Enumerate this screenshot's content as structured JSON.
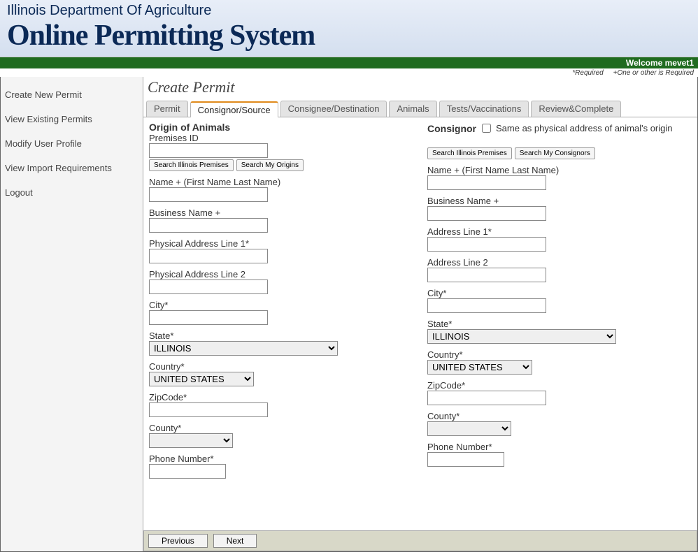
{
  "header": {
    "department": "Illinois Department Of Agriculture",
    "system": "Online Permitting System"
  },
  "welcome": "Welcome mevet1",
  "hints": {
    "required": "*Required",
    "oneOrOther": "+One or other is Required"
  },
  "sidebar": {
    "items": [
      "Create New Permit",
      "View Existing Permits",
      "Modify User Profile",
      "View Import Requirements",
      "Logout"
    ]
  },
  "page": {
    "title": "Create Permit"
  },
  "tabs": [
    "Permit",
    "Consignor/Source",
    "Consignee/Destination",
    "Animals",
    "Tests/Vaccinations",
    "Review&Complete"
  ],
  "origin": {
    "heading": "Origin of Animals",
    "premises_label": "Premises ID",
    "premises_value": "",
    "search_premises_btn": "Search Illinois Premises",
    "search_origins_btn": "Search My Origins",
    "name_label": "Name + (First Name Last Name)",
    "name_value": "",
    "business_label": "Business Name +",
    "business_value": "",
    "addr1_label": "Physical Address Line 1*",
    "addr1_value": "",
    "addr2_label": "Physical Address Line 2",
    "addr2_value": "",
    "city_label": "City*",
    "city_value": "",
    "state_label": "State*",
    "state_value": "ILLINOIS",
    "country_label": "Country*",
    "country_value": "UNITED STATES",
    "zip_label": "ZipCode*",
    "zip_value": "",
    "county_label": "County*",
    "county_value": "",
    "phone_label": "Phone Number*",
    "phone_value": ""
  },
  "consignor": {
    "heading": "Consignor",
    "same_label": "Same as physical address of animal's origin",
    "search_premises_btn": "Search Illinois Premises",
    "search_consignors_btn": "Search My Consignors",
    "name_label": "Name + (First Name Last Name)",
    "name_value": "",
    "business_label": "Business Name +",
    "business_value": "",
    "addr1_label": "Address Line 1*",
    "addr1_value": "",
    "addr2_label": "Address Line 2",
    "addr2_value": "",
    "city_label": "City*",
    "city_value": "",
    "state_label": "State*",
    "state_value": "ILLINOIS",
    "country_label": "Country*",
    "country_value": "UNITED STATES",
    "zip_label": "ZipCode*",
    "zip_value": "",
    "county_label": "County*",
    "county_value": "",
    "phone_label": "Phone Number*",
    "phone_value": ""
  },
  "footer": {
    "previous": "Previous",
    "next": "Next"
  }
}
